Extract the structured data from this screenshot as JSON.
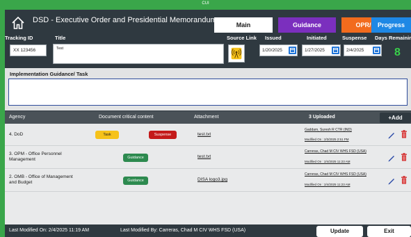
{
  "banner": {
    "classification": "CUI"
  },
  "header": {
    "title": "DSD - Executive Order and Presidential Memorandums",
    "tabs": [
      {
        "label": "Main"
      },
      {
        "label": "Guidance"
      },
      {
        "label": "OPR/OCR"
      },
      {
        "label": "Progress"
      }
    ]
  },
  "form": {
    "labels": {
      "tracking_id": "Tracking ID",
      "title": "Title",
      "source_link": "Source Link",
      "issued": "Issued",
      "initiated": "Initiated",
      "suspense": "Suspense",
      "days_remaining": "Days Remaining"
    },
    "tracking_id": "XX 123456",
    "title": "Test",
    "issued": "1/20/2025",
    "initiated": "1/27/2025",
    "suspense": "2/4/2025",
    "days_remaining": "8"
  },
  "guidance": {
    "label": "Implementation Guidance/ Task",
    "value": ""
  },
  "table": {
    "headers": {
      "agency": "Agency",
      "critical": "Document critical content",
      "attachment": "Attachment",
      "uploaded": "3 Uploaded",
      "add": "+Add"
    },
    "rows": [
      {
        "agency": "4. DoD",
        "pills": [
          "Task",
          "Suspense"
        ],
        "attachment": "test.txt",
        "modified_by": "Gaddam, Suresh R CTR (IND)",
        "modified_on": "Modified On : 2/3/2025 2:51 PM"
      },
      {
        "agency": "3. OPM - Office Personnel Management",
        "pills": [
          "Guidance"
        ],
        "attachment": "test.txt",
        "modified_by": "Carreras, Chad M CIV WHS FSD (USA)",
        "modified_on": "Modified On : 2/4/2025 11:23 AM"
      },
      {
        "agency": "2. OMB - Office of Management and Budget",
        "pills": [
          "Guidance"
        ],
        "attachment": "DISA logo3.jpg",
        "modified_by": "Carreras, Chad M CIV WHS FSD (USA)",
        "modified_on": "Modified On : 2/4/2025 11:23 AM"
      }
    ]
  },
  "footer": {
    "last_modified_on": "Last Modified On: 2/4/2025 11:19 AM",
    "last_modified_by": "Last Modified By: Carreras, Chad M CIV WHS FSD (USA)",
    "update": "Update",
    "exit": "Exit"
  },
  "colors": {
    "background_green": "#3aa64a",
    "dark_panel": "#2f3940",
    "guidance_tab": "#7b2fbe",
    "opr_tab": "#f26b1d",
    "progress_tab": "#1e88e5",
    "days_remaining": "#38d14a",
    "task_pill": "#f6c21a",
    "suspense_pill": "#c41a1a",
    "guidance_pill": "#2d8a4f"
  },
  "icons": {
    "home": "home-icon",
    "source_link": "signal-tower-icon",
    "calendar": "calendar-icon",
    "edit": "pencil-icon",
    "delete": "trash-icon"
  }
}
